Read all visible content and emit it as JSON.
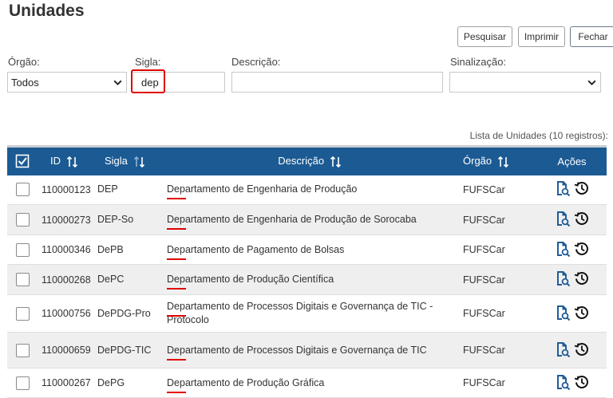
{
  "page": {
    "title": "Unidades"
  },
  "toolbar": {
    "search_label": "Pesquisar",
    "print_label": "Imprimir",
    "close_label": "Fechar"
  },
  "filters": {
    "orgao": {
      "label": "Órgão:",
      "value": "Todos"
    },
    "sigla": {
      "label": "Sigla:",
      "value": "dep"
    },
    "descricao": {
      "label": "Descrição:",
      "value": ""
    },
    "sinalizacao": {
      "label": "Sinalização:",
      "value": ""
    }
  },
  "list": {
    "count_text": "Lista de Unidades (10 registros):",
    "columns": {
      "id": "ID",
      "sigla": "Sigla",
      "descricao": "Descrição",
      "orgao": "Órgão",
      "acoes": "Ações"
    },
    "rows": [
      {
        "id": "110000123",
        "sigla": "DEP",
        "desc_prefix": "Dep",
        "desc_rest": "artamento de Engenharia de Produção",
        "orgao": "FUFSCar"
      },
      {
        "id": "110000273",
        "sigla": "DEP-So",
        "desc_prefix": "Dep",
        "desc_rest": "artamento de Engenharia de Produção de Sorocaba",
        "orgao": "FUFSCar"
      },
      {
        "id": "110000346",
        "sigla": "DePB",
        "desc_prefix": "Dep",
        "desc_rest": "artamento de Pagamento de Bolsas",
        "orgao": "FUFSCar"
      },
      {
        "id": "110000268",
        "sigla": "DePC",
        "desc_prefix": "Dep",
        "desc_rest": "artamento de Produção Científica",
        "orgao": "FUFSCar"
      },
      {
        "id": "110000756",
        "sigla": "DePDG-Pro",
        "desc_prefix": "Dep",
        "desc_rest": "artamento de Processos Digitais e Governança de TIC - Protocolo",
        "orgao": "FUFSCar"
      },
      {
        "id": "110000659",
        "sigla": "DePDG-TIC",
        "desc_prefix": "Dep",
        "desc_rest": "artamento de Processos Digitais e Governança de TIC",
        "orgao": "FUFSCar"
      },
      {
        "id": "110000267",
        "sigla": "DePG",
        "desc_prefix": "Dep",
        "desc_rest": "artamento de Produção Gráfica",
        "orgao": "FUFSCar"
      }
    ]
  },
  "icons": [
    "select-all-icon",
    "sort-icon",
    "consult-document-icon",
    "history-icon",
    "chevron-down-icon"
  ],
  "colors": {
    "header": "#1b5a93",
    "highlight": "#e00000",
    "icon": "#1f5c99"
  }
}
